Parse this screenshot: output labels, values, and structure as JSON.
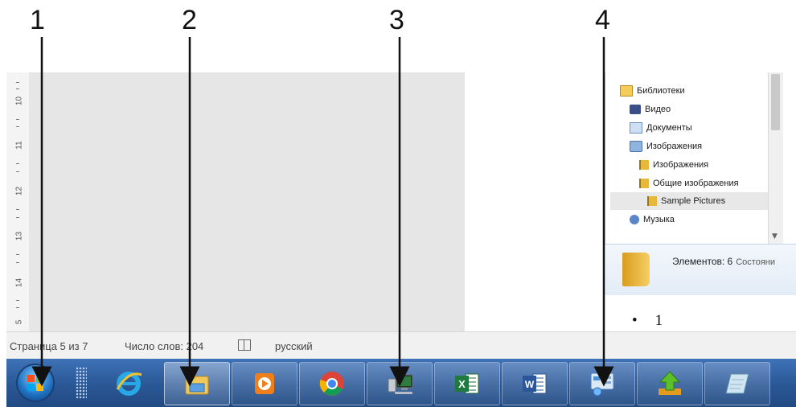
{
  "callouts": [
    {
      "number": "1",
      "target": "start-button"
    },
    {
      "number": "2",
      "target": "explorer-taskbar-button"
    },
    {
      "number": "3",
      "target": "computer-taskbar-button"
    },
    {
      "number": "4",
      "target": "control-panel-taskbar-button"
    }
  ],
  "ruler": {
    "labels": [
      "10",
      "11",
      "12",
      "13",
      "14",
      "5"
    ]
  },
  "explorer": {
    "tree": [
      {
        "label": "Библиотеки",
        "icon": "library-icon",
        "indent": 0
      },
      {
        "label": "Видео",
        "icon": "video-library-icon",
        "indent": 1
      },
      {
        "label": "Документы",
        "icon": "documents-library-icon",
        "indent": 1
      },
      {
        "label": "Изображения",
        "icon": "pictures-library-icon",
        "indent": 1
      },
      {
        "label": "Изображения",
        "icon": "folder-icon",
        "indent": 2
      },
      {
        "label": "Общие изображения",
        "icon": "folder-icon",
        "indent": 2
      },
      {
        "label": "Sample Pictures",
        "icon": "folder-icon",
        "indent": 3,
        "selected": true
      },
      {
        "label": "Музыка",
        "icon": "music-library-icon",
        "indent": 1
      }
    ],
    "details": {
      "items_text": "Элементов: 6",
      "state_text": "Состояни"
    }
  },
  "document": {
    "bullet_symbol": "•",
    "bullet_text": "1"
  },
  "statusbar": {
    "page": "Страница 5 из 7",
    "words": "Число слов: 204",
    "language": "русский"
  },
  "taskbar": {
    "background": "#2a5795",
    "buttons": [
      {
        "name": "internet-explorer",
        "icon": "internet-explorer-icon",
        "state": "normal"
      },
      {
        "name": "explorer",
        "icon": "explorer-folder-icon",
        "state": "active"
      },
      {
        "name": "media-player",
        "icon": "media-player-icon",
        "state": "pinned"
      },
      {
        "name": "chrome",
        "icon": "chrome-icon",
        "state": "pinned"
      },
      {
        "name": "computer",
        "icon": "computer-icon",
        "state": "pinned"
      },
      {
        "name": "excel",
        "icon": "excel-icon",
        "state": "pinned",
        "letter": "X"
      },
      {
        "name": "word",
        "icon": "word-icon",
        "state": "pinned",
        "letter": "W"
      },
      {
        "name": "control-panel",
        "icon": "control-panel-icon",
        "state": "pinned"
      },
      {
        "name": "upload-app",
        "icon": "green-upload-icon",
        "state": "pinned"
      },
      {
        "name": "notepad",
        "icon": "notepad-icon",
        "state": "pinned"
      }
    ]
  }
}
